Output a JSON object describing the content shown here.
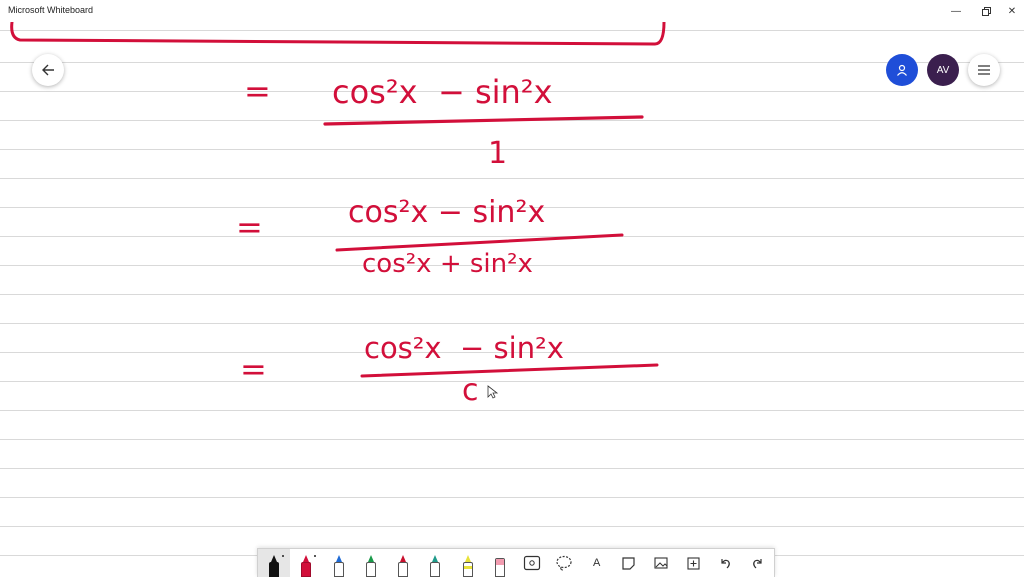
{
  "titlebar": {
    "app_title": "Microsoft Whiteboard",
    "minimize_icon": "minimize-icon",
    "restore_icon": "restore-icon",
    "close_icon": "close-icon"
  },
  "top_right": {
    "avatar_initials": "AV",
    "share_icon": "person-icon",
    "menu_icon": "hamburger-menu-icon"
  },
  "left_controls": {
    "back_icon": "arrow-left-icon"
  },
  "ink": {
    "color": "#d20f3a",
    "equations": [
      {
        "equals": "=",
        "numerator": "cos²x  − sin²x",
        "denominator": "1"
      },
      {
        "equals": "=",
        "numerator": "cos²x − sin²x",
        "denominator": "cos²x + sin²x"
      },
      {
        "equals": "=",
        "numerator": "cos²x  − sin²x",
        "denominator": "c"
      }
    ]
  },
  "toolbar": {
    "tools": [
      {
        "name": "black-pen",
        "icon": "pen-icon",
        "color": "#111111",
        "active": true
      },
      {
        "name": "red-pen",
        "icon": "pen-icon",
        "color": "#d20f3a",
        "active": false
      },
      {
        "name": "blue-pen",
        "icon": "pen-icon",
        "color": "#1f6bd6",
        "active": false
      },
      {
        "name": "green-pen",
        "icon": "pen-icon",
        "color": "#1a9a4a",
        "active": false
      },
      {
        "name": "red-pen-2",
        "icon": "pen-icon",
        "color": "#c8102e",
        "active": false
      },
      {
        "name": "teal-pen",
        "icon": "pen-icon",
        "color": "#1f9a8a",
        "active": false
      },
      {
        "name": "highlighter",
        "icon": "highlighter-icon",
        "color": "#e8e23a",
        "active": false
      },
      {
        "name": "eraser",
        "icon": "eraser-icon",
        "color": "#f29cb0",
        "active": false
      },
      {
        "name": "ruler",
        "icon": "ruler-icon",
        "active": false
      },
      {
        "name": "lasso",
        "icon": "lasso-icon",
        "active": false
      },
      {
        "name": "text",
        "icon": "text-icon",
        "glyph": "A",
        "active": false
      },
      {
        "name": "note",
        "icon": "sticky-note-icon",
        "active": false
      },
      {
        "name": "image",
        "icon": "image-icon",
        "active": false
      },
      {
        "name": "insert",
        "icon": "plus-icon",
        "active": false
      },
      {
        "name": "undo",
        "icon": "undo-icon",
        "active": false
      },
      {
        "name": "redo",
        "icon": "redo-icon",
        "active": false
      }
    ]
  }
}
